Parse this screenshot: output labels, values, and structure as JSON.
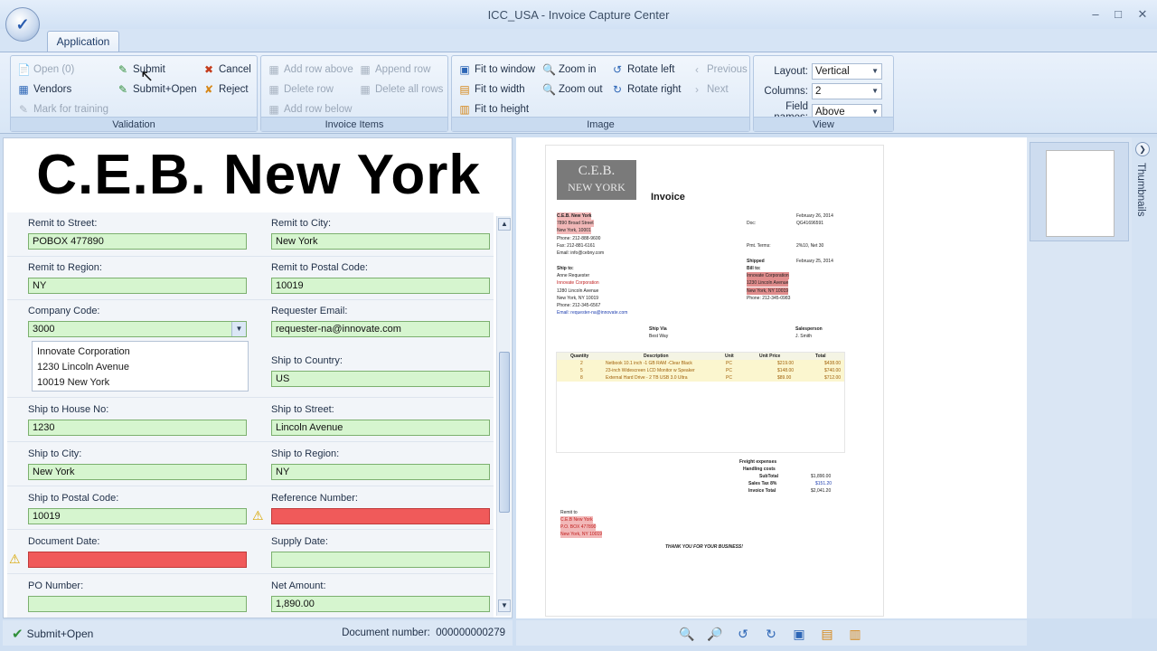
{
  "window": {
    "title": "ICC_USA - Invoice Capture Center"
  },
  "ribbon": {
    "tab": "Application",
    "validation": {
      "label": "Validation",
      "open": "Open (0)",
      "submit": "Submit",
      "cancel": "Cancel",
      "vendors": "Vendors",
      "submit_open": "Submit+Open",
      "reject": "Reject",
      "mark_training": "Mark for training"
    },
    "invoice_items": {
      "label": "Invoice Items",
      "add_row_above": "Add row above",
      "append_row": "Append row",
      "delete_row": "Delete row",
      "delete_all_rows": "Delete all rows",
      "add_row_below": "Add row below"
    },
    "image": {
      "label": "Image",
      "fit_window": "Fit to window",
      "zoom_in": "Zoom in",
      "rotate_left": "Rotate left",
      "previous": "Previous",
      "fit_width": "Fit to width",
      "zoom_out": "Zoom out",
      "rotate_right": "Rotate right",
      "next": "Next",
      "fit_height": "Fit to height"
    },
    "view": {
      "label": "View",
      "layout_label": "Layout:",
      "layout_value": "Vertical",
      "columns_label": "Columns:",
      "columns_value": "2",
      "fieldnames_label": "Field names:",
      "fieldnames_value": "Above"
    }
  },
  "banner": {
    "vendor_logo_text": "C.E.B. New York"
  },
  "form": {
    "remit_street": {
      "label": "Remit to Street:",
      "value": "POBOX 477890"
    },
    "remit_city": {
      "label": "Remit to City:",
      "value": "New York"
    },
    "remit_region": {
      "label": "Remit to Region:",
      "value": "NY"
    },
    "remit_postal": {
      "label": "Remit to Postal Code:",
      "value": "10019"
    },
    "company_code": {
      "label": "Company Code:",
      "value": "3000"
    },
    "company_address": [
      "Innovate Corporation",
      "1230 Lincoln Avenue",
      "10019 New York"
    ],
    "requester_email": {
      "label": "Requester Email:",
      "value": "requester-na@innovate.com"
    },
    "ship_country": {
      "label": "Ship to Country:",
      "value": "US"
    },
    "ship_house": {
      "label": "Ship to House No:",
      "value": "1230"
    },
    "ship_street": {
      "label": "Ship to Street:",
      "value": "Lincoln Avenue"
    },
    "ship_city": {
      "label": "Ship to City:",
      "value": "New York"
    },
    "ship_region": {
      "label": "Ship to Region:",
      "value": "NY"
    },
    "ship_postal": {
      "label": "Ship to Postal Code:",
      "value": "10019"
    },
    "reference_number": {
      "label": "Reference Number:",
      "value": ""
    },
    "document_date": {
      "label": "Document Date:",
      "value": ""
    },
    "supply_date": {
      "label": "Supply Date:",
      "value": ""
    },
    "po_number": {
      "label": "PO Number:",
      "value": ""
    },
    "net_amount": {
      "label": "Net Amount:",
      "value": "1,890.00"
    }
  },
  "status": {
    "submit_open": "Submit+Open",
    "doc_number_label": "Document number:",
    "doc_number": "000000000279"
  },
  "invoice_image": {
    "logo_line1": "C.E.B.",
    "logo_line2": "NEW YORK",
    "title": "Invoice",
    "vendor_lines": [
      "C.E.B. New York",
      "7890 Broad Street",
      "New York, 10001",
      "Phone: 212-888-9600",
      "Fax: 212-881-6161",
      "Email: info@cebny.com"
    ],
    "date": "February 26, 2014",
    "doc_label": "Doc:",
    "doc_value": "QG41696591",
    "pmt_label": "Pmt. Terms:",
    "pmt_value": "2%10, Net 30",
    "shipped_label": "Shipped",
    "shipped_value": "February 25, 2014",
    "ship_to_lines": [
      "Ship to:",
      "Anne Requester",
      "Innovate Corporation",
      "1280 Lincoln Avenue",
      "New York, NY 10019",
      "Phone: 212-345-6567",
      "Email: requester-na@innovate.com"
    ],
    "bill_to_lines": [
      "Bill to:",
      "Innovate Corporation",
      "1230 Lincoln Avenue",
      "New York, NY 10019",
      "Phone: 212-345-0983"
    ],
    "ship_via_label": "Ship Via",
    "ship_via_value": "Best Way",
    "salesperson_label": "Salesperson",
    "salesperson_value": "J. Smith",
    "table_headers": [
      "Quantity",
      "Description",
      "Unit",
      "Unit Price",
      "Total"
    ],
    "items": [
      [
        "2",
        "Netbook 10.1 inch -1 GB RAM -Clear Black",
        "PC",
        "$219.00",
        "$438.00"
      ],
      [
        "5",
        "23-inch Widescreen LCD Monitor w Speaker",
        "PC",
        "$148.00",
        "$740.00"
      ],
      [
        "8",
        "External Hard Drive - 2 TB USB 3.0 Ultra",
        "PC",
        "$89.00",
        "$712.00"
      ]
    ],
    "totals": [
      [
        "Freight expenses",
        ""
      ],
      [
        "Handling costs",
        ""
      ],
      [
        "SubTotal",
        "$1,890.00"
      ],
      [
        "Sales Tax 8%",
        "$151.20"
      ],
      [
        "Invoice Total",
        "$2,041.20"
      ]
    ],
    "remit_lines": [
      "Remit to",
      "C.E.B New York",
      "P.O. BOX 477890",
      "New York, NY 10019"
    ],
    "thanks": "THANK YOU FOR YOUR BUSINESS!"
  },
  "thumbnails": {
    "label": "Thumbnails"
  }
}
